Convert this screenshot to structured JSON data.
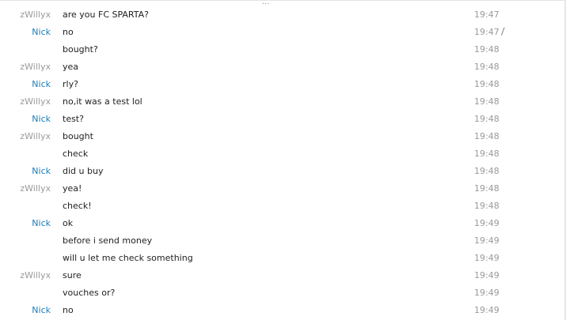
{
  "chat": {
    "messages": [
      {
        "sender": "zWillyx",
        "text": "are you FC SPARTA?",
        "time": "19:47"
      },
      {
        "sender": "Nick",
        "text": "no",
        "time": "19:47",
        "edited": true
      },
      {
        "sender": "",
        "text": "bought?",
        "time": "19:48"
      },
      {
        "sender": "zWillyx",
        "text": "yea",
        "time": "19:48"
      },
      {
        "sender": "Nick",
        "text": "rly?",
        "time": "19:48"
      },
      {
        "sender": "zWillyx",
        "text": "no,it was a test lol",
        "time": "19:48"
      },
      {
        "sender": "Nick",
        "text": "test?",
        "time": "19:48"
      },
      {
        "sender": "zWillyx",
        "text": "bought",
        "time": "19:48"
      },
      {
        "sender": "",
        "text": "check",
        "time": "19:48"
      },
      {
        "sender": "Nick",
        "text": "did u buy",
        "time": "19:48"
      },
      {
        "sender": "zWillyx",
        "text": "yea!",
        "time": "19:48"
      },
      {
        "sender": "",
        "text": "check!",
        "time": "19:48"
      },
      {
        "sender": "Nick",
        "text": "ok",
        "time": "19:49"
      },
      {
        "sender": "",
        "text": "before i send money",
        "time": "19:49"
      },
      {
        "sender": "",
        "text": "will u let me check something",
        "time": "19:49"
      },
      {
        "sender": "zWillyx",
        "text": "sure",
        "time": "19:49"
      },
      {
        "sender": "",
        "text": "vouches or?",
        "time": "19:49"
      },
      {
        "sender": "Nick",
        "text": "no",
        "time": "19:49"
      }
    ]
  },
  "colors": {
    "zwillyx": "#9a9a9a",
    "nick": "#1b7db8",
    "text": "#222222",
    "time": "#9a9a9a"
  },
  "icons": {
    "grip": "resize-grip-icon",
    "edited": "pencil-edit-icon"
  }
}
